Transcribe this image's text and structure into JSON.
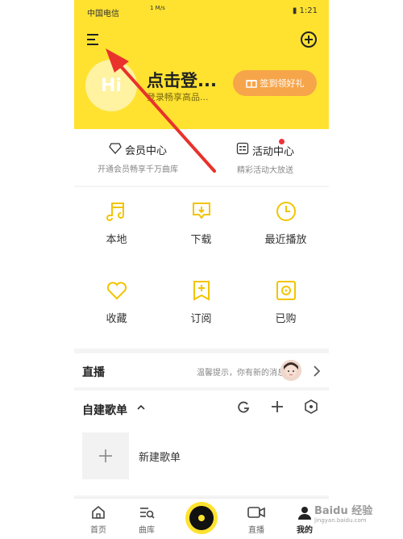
{
  "colors": {
    "brand_yellow": "#ffe230",
    "signin_orange": "#f7a54a",
    "red_dot": "#f0303a",
    "annotation_red": "#e8322b"
  },
  "status_bar": {
    "carrier": "中国电信",
    "speed": "1 M/s",
    "time": "1:21"
  },
  "header": {
    "avatar_text": "Hi",
    "login_title": "点击登...",
    "login_sub": "登录畅享高品...",
    "signin_button": "签到领好礼"
  },
  "quick": {
    "member": {
      "title": "会员中心",
      "sub": "开通会员畅享千万曲库"
    },
    "activity": {
      "title": "活动中心",
      "sub": "精彩活动大放送"
    }
  },
  "grid": {
    "local": "本地",
    "download": "下载",
    "recent": "最近播放",
    "favorite": "收藏",
    "subscribe": "订阅",
    "purchased": "已购"
  },
  "live": {
    "title": "直播",
    "message": "温馨提示，你有新的消息！"
  },
  "playlist": {
    "title": "自建歌单",
    "new_label": "新建歌单"
  },
  "bottom_nav": {
    "home": "首页",
    "library": "曲库",
    "live": "直播",
    "mine": "我的"
  },
  "watermark": {
    "text": "Baidu 经验",
    "sub": "jingyan.baidu.com"
  }
}
